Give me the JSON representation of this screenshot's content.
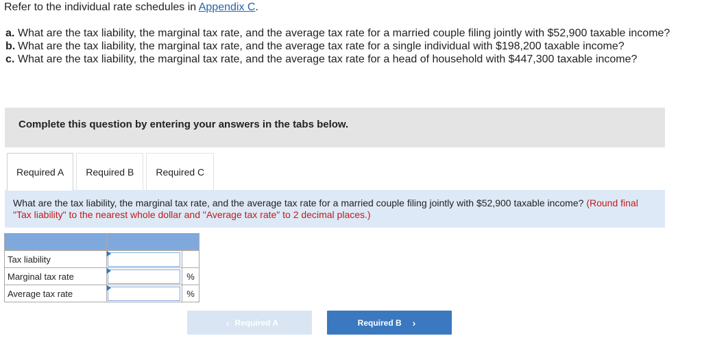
{
  "intro": {
    "text": "Refer to the individual rate schedules in ",
    "link": "Appendix C",
    "suffix": "."
  },
  "questions": [
    {
      "label": "a.",
      "text": "What are the tax liability, the marginal tax rate, and the average tax rate for a married couple filing jointly with $52,900 taxable income?"
    },
    {
      "label": "b.",
      "text": "What are the tax liability, the marginal tax rate, and the average tax rate for a single individual with $198,200 taxable income?"
    },
    {
      "label": "c.",
      "text": "What are the tax liability, the marginal tax rate, and the average tax rate for a head of household with $447,300 taxable income?"
    }
  ],
  "banner": "Complete this question by entering your answers in the tabs below.",
  "tabs": [
    {
      "label": "Required A",
      "active": true
    },
    {
      "label": "Required B",
      "active": false
    },
    {
      "label": "Required C",
      "active": false
    }
  ],
  "prompt": {
    "text": "What are the tax liability, the marginal tax rate, and the average tax rate for a married couple filing jointly with $52,900 taxable income? ",
    "instruction": "(Round final \"Tax liability\" to the nearest whole dollar and \"Average tax rate\" to 2 decimal places.)"
  },
  "table": {
    "rows": [
      {
        "label": "Tax liability",
        "value": "",
        "unit": ""
      },
      {
        "label": "Marginal tax rate",
        "value": "",
        "unit": "%"
      },
      {
        "label": "Average tax rate",
        "value": "",
        "unit": "%"
      }
    ]
  },
  "nav": {
    "prev_label": "Required A",
    "next_label": "Required B",
    "prev_icon": "‹",
    "next_icon": "›"
  },
  "colors": {
    "link": "#2563a9",
    "instruction": "#c21a1a",
    "table_header": "#7fa9dc",
    "next_button": "#3a78c0",
    "prev_button": "#d9e5f3"
  }
}
